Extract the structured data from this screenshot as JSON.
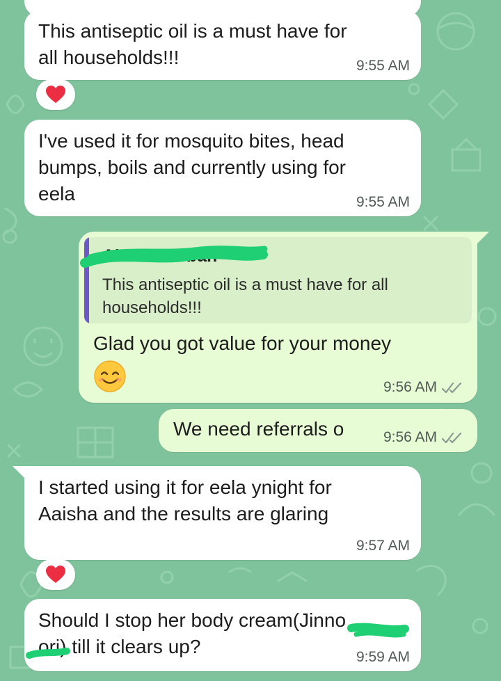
{
  "colors": {
    "wallpaper": "#7fc39d",
    "incoming_bubble": "#ffffff",
    "outgoing_bubble": "#e7fcd5",
    "quote_bar": "#6f58c9",
    "redaction": "#1fcf73"
  },
  "messages": [
    {
      "direction": "incoming",
      "text": "This antiseptic oil is a must have for\nall households!!!",
      "time": "9:55 AM",
      "reaction": "red-heart"
    },
    {
      "direction": "incoming",
      "text": "I've used it for mosquito bites, head\nbumps, boils and currently using for\neela",
      "time": "9:55 AM"
    },
    {
      "direction": "outgoing",
      "quoted": {
        "author": "Al  ish   a    R    bah",
        "text": "This antiseptic oil is a must have for all\nhouseholds!!!"
      },
      "text": "Glad you got value for your money",
      "emoji": "smiling-face-emoji",
      "time": "9:56 AM",
      "status": "read-double-check"
    },
    {
      "direction": "outgoing",
      "text": "We need referrals o",
      "time": "9:56 AM",
      "status": "read-double-check"
    },
    {
      "direction": "incoming",
      "text": "I started using it for eela ynight for\nAaisha and the results are glaring",
      "time": "9:57 AM",
      "reaction": "red-heart"
    },
    {
      "direction": "incoming",
      "text": "Should I stop her body cream(Jinno\nori) till it clears up?",
      "time": "9:59 AM"
    }
  ]
}
